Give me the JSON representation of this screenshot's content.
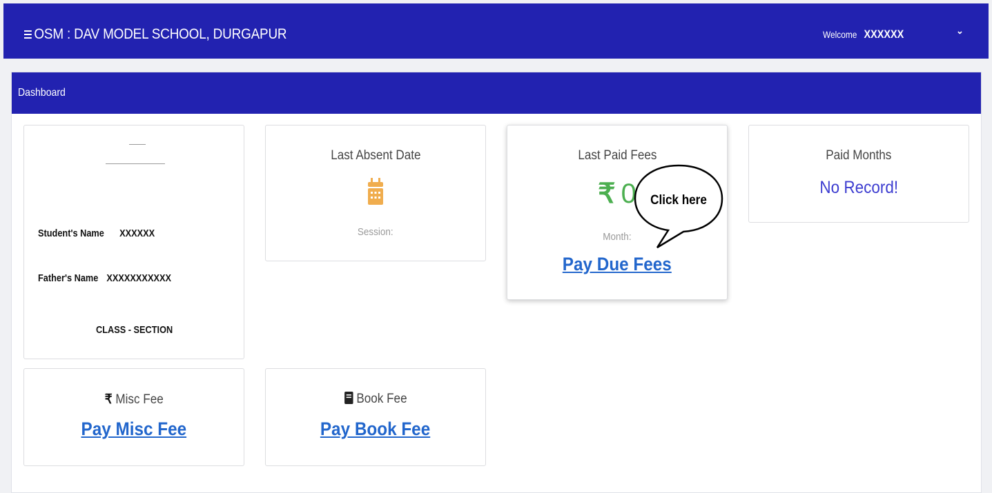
{
  "header": {
    "title": "OSM : DAV MODEL SCHOOL, DURGAPUR",
    "welcome_label": "Welcome",
    "user_name": "XXXXXX",
    "dropdown_icon": "chevron-down-icon"
  },
  "dashboard": {
    "title": "Dashboard"
  },
  "student": {
    "photo_icon": "avatar-placeholder",
    "name_label": "Student's Name",
    "name_value": "XXXXXX",
    "father_label": "Father's Name",
    "father_value": "XXXXXXXXXXX",
    "class_section": "CLASS - SECTION"
  },
  "absent": {
    "title": "Last Absent Date",
    "icon": "calendar-icon",
    "icon_color": "#f0ad4e",
    "session_label": "Session:"
  },
  "last_paid": {
    "title": "Last Paid Fees",
    "currency_symbol": "₹",
    "amount": "0",
    "amount_color": "#4caf50",
    "month_label": "Month:",
    "pay_link": "Pay Due Fees"
  },
  "callout": {
    "text": "Click here"
  },
  "paid_months": {
    "title": "Paid Months",
    "value": "No Record!",
    "value_color": "#3d3dd0"
  },
  "misc_fee": {
    "icon": "rupee-icon",
    "symbol": "₹",
    "title": "Misc Fee",
    "pay_link": "Pay Misc Fee"
  },
  "book_fee": {
    "icon": "book-icon",
    "title": "Book Fee",
    "pay_link": "Pay Book Fee"
  },
  "colors": {
    "header_bg": "#2222b0",
    "link": "#2266cc"
  }
}
